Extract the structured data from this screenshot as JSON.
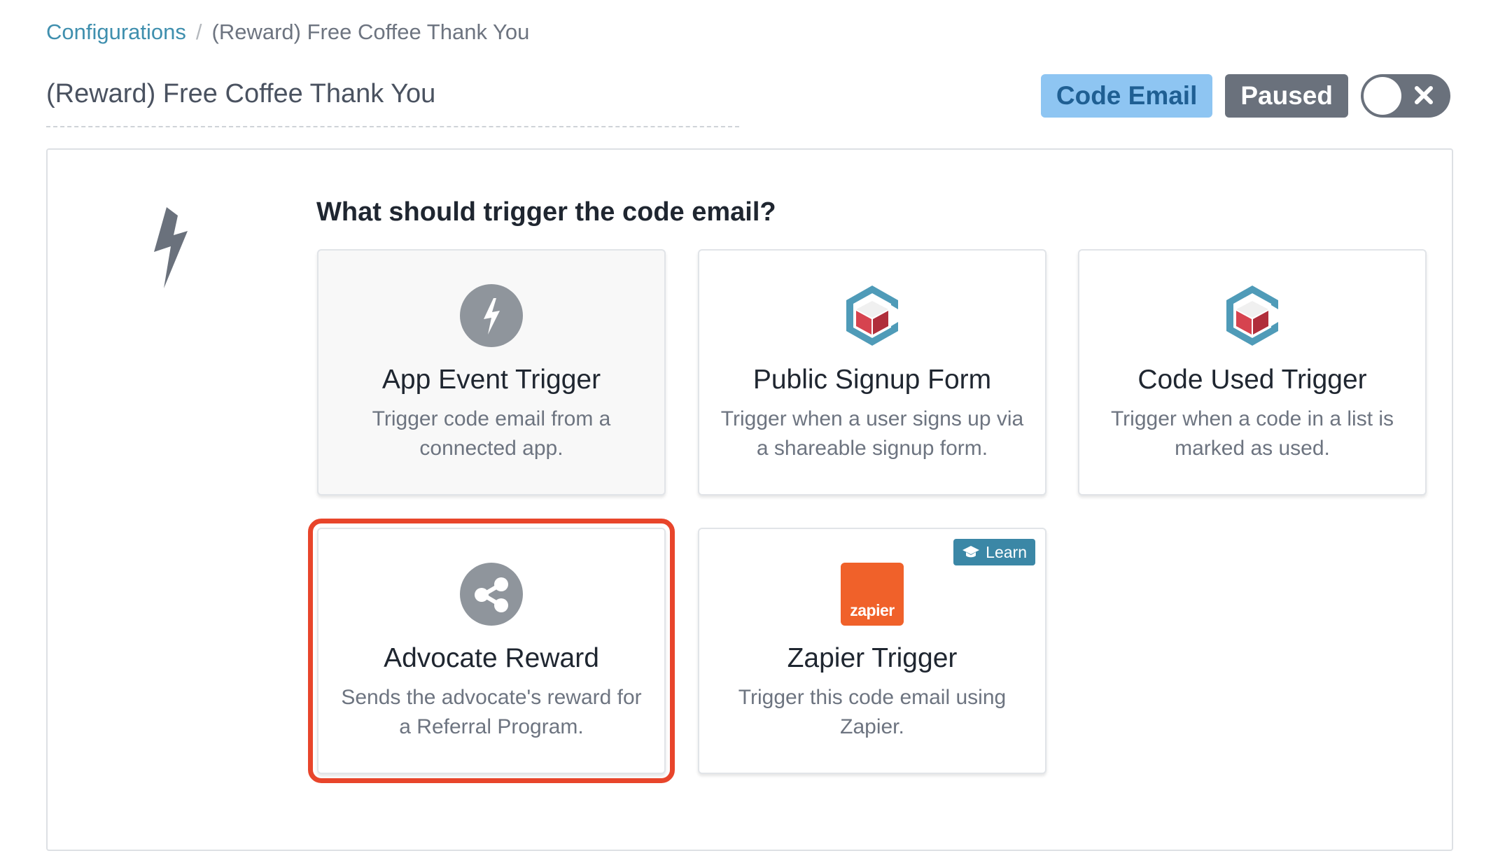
{
  "breadcrumb": {
    "root": "Configurations",
    "separator": "/",
    "current": "(Reward) Free Coffee Thank You"
  },
  "page_title": "(Reward) Free Coffee Thank You",
  "header": {
    "type_badge": "Code Email",
    "status_badge": "Paused",
    "toggle_state": "off"
  },
  "panel": {
    "question": "What should trigger the code email?",
    "cards": [
      {
        "title": "App Event Trigger",
        "description": "Trigger code email from a connected app.",
        "icon": "lightning-circle-icon"
      },
      {
        "title": "Public Signup Form",
        "description": "Trigger when a user signs up via a shareable signup form.",
        "icon": "cube-logo-icon"
      },
      {
        "title": "Code Used Trigger",
        "description": "Trigger when a code in a list is marked as used.",
        "icon": "cube-logo-icon"
      },
      {
        "title": "Advocate Reward",
        "description": "Sends the advocate's reward for a Referral Program.",
        "icon": "share-circle-icon",
        "highlighted": true
      },
      {
        "title": "Zapier Trigger",
        "description": "Trigger this code email using Zapier.",
        "icon": "zapier-logo-icon",
        "badge": "Learn",
        "logo_text": "zapier"
      }
    ]
  },
  "colors": {
    "link": "#3f8fae",
    "type_badge_bg": "#8ec5f2",
    "status_badge_bg": "#6a717c",
    "highlight": "#e8452b",
    "zapier": "#f0612a",
    "learn_badge": "#3b87a6"
  }
}
